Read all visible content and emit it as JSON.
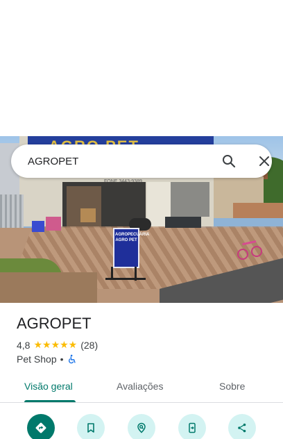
{
  "search": {
    "query": "AGROPET"
  },
  "photo": {
    "banner_text": "AGRO PET",
    "banner_sub": "FONE 3443-9389",
    "sign_text": "AGROPECUÁRIA AGRO PET"
  },
  "place": {
    "name": "AGROPET",
    "rating": "4,8",
    "stars": "★★★★★",
    "review_count": "(28)",
    "category": "Pet Shop",
    "separator": "•"
  },
  "tabs": [
    {
      "label": "Visão geral",
      "active": true
    },
    {
      "label": "Avaliações",
      "active": false
    },
    {
      "label": "Sobre",
      "active": false
    }
  ],
  "actions": [
    {
      "icon": "directions-icon"
    },
    {
      "icon": "bookmark-icon"
    },
    {
      "icon": "nearby-icon"
    },
    {
      "icon": "send-to-phone-icon"
    },
    {
      "icon": "share-icon"
    }
  ],
  "colors": {
    "accent": "#00796b",
    "action_bg": "#d3f3f2",
    "star": "#fbbc04"
  }
}
